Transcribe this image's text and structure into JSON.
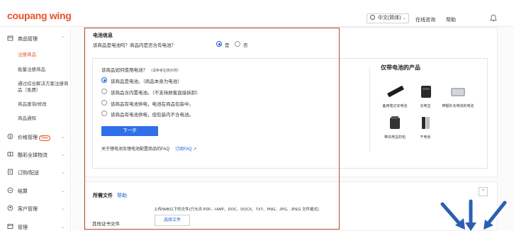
{
  "header": {
    "logo_part1": "coupang",
    "logo_part2": "wing",
    "language": "中文(简体)",
    "links": [
      "在线咨询",
      "帮助"
    ]
  },
  "sidebar": {
    "groups": [
      {
        "label": "商品管理",
        "icon": "box-icon"
      },
      {
        "label": "价格管理",
        "icon": "price-icon",
        "badge": "New"
      },
      {
        "label": "酷彩全球物流",
        "icon": "logistics-icon"
      },
      {
        "label": "订购/配送",
        "icon": "delivery-icon"
      },
      {
        "label": "结算",
        "icon": "settlement-icon"
      },
      {
        "label": "客户管理",
        "icon": "customer-icon"
      },
      {
        "label": "管理",
        "icon": "admin-icon"
      }
    ],
    "sub_items": [
      "注册商品",
      "批量注册商品",
      "通过综合解决方案注册商品（免费）",
      "商品查询/修改",
      "商品通知"
    ]
  },
  "battery": {
    "title": "电池信息",
    "question": "该商品是电池吗？商品内是否含有电池？",
    "yes": "是",
    "no": "否",
    "sub_question": "该商品如何使用电池？",
    "sub_note": "（请参考右侧示例）",
    "options": [
      "该商品是电池。（商品本身为电池）",
      "该商品含内置电池。（不支持顾客直接拆卸）",
      "该商品有电池供电，电池在商品包装中。",
      "该商品有电池供电，但包装内不含电池。"
    ],
    "next_button": "下一步",
    "faq_text": "关于锂电池及锂电池配置商品的FAQ",
    "faq_link": "订阅FAQ"
  },
  "products": {
    "title": "仅带电池的产品",
    "items": [
      "备用笔记本电池",
      "充电宝",
      "带额外充电线的电池",
      "带充电宝的包",
      "干电池"
    ]
  },
  "files": {
    "title": "所需文件",
    "help": "帮助",
    "hint": "上传5MB以下的文件(只允许 PDF、HWP、DOC、DOCX、TXT、PNG、JPG、JPEG 文件格式)",
    "label": "其他证书文件",
    "button": "选择文件"
  },
  "colors": {
    "accent": "#e8522a",
    "primary": "#2f6fe8",
    "frame": "#b8492e",
    "arrow": "#2b5fb3"
  }
}
